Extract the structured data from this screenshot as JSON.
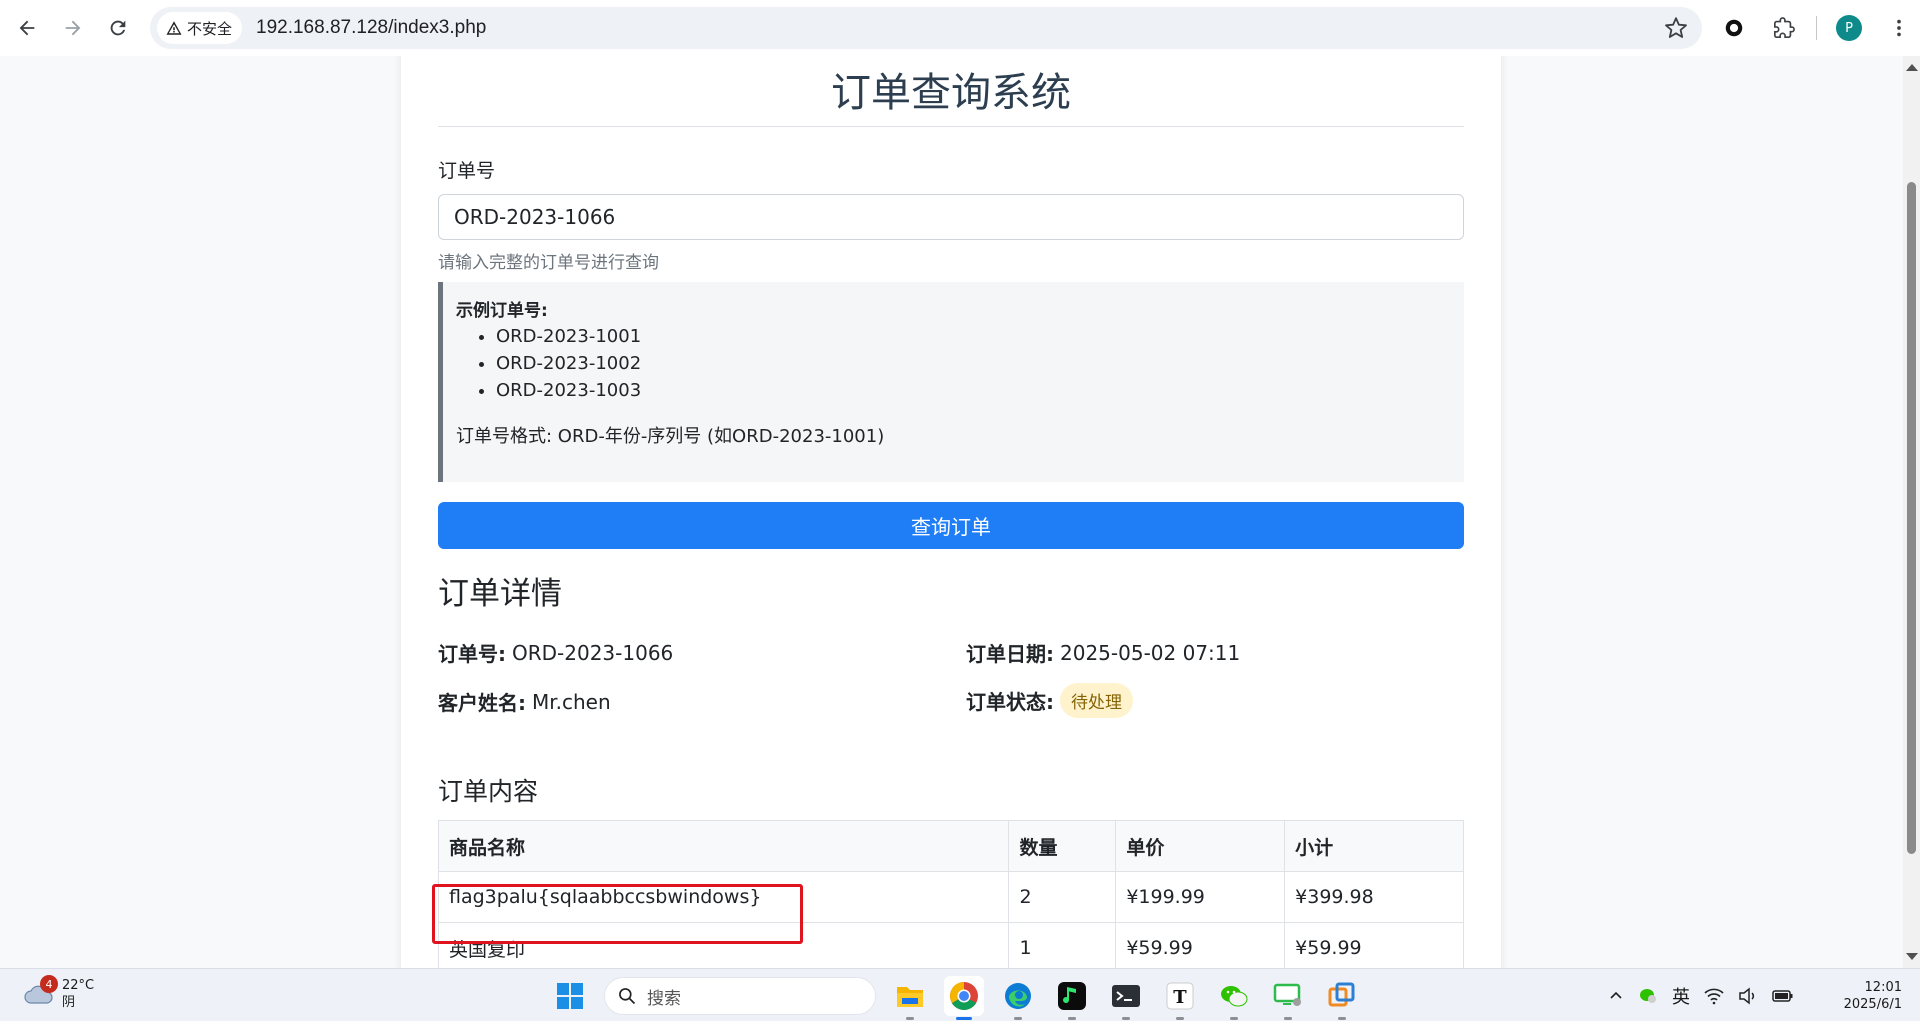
{
  "browser": {
    "security_label": "不安全",
    "url": "192.168.87.128/index3.php",
    "profile_initial": "P"
  },
  "page": {
    "title": "订单查询系统",
    "form": {
      "order_label": "订单号",
      "order_value": "ORD-2023-1066",
      "help_text": "请输入完整的订单号进行查询",
      "examples_title": "示例订单号:",
      "examples": [
        "ORD-2023-1001",
        "ORD-2023-1002",
        "ORD-2023-1003"
      ],
      "format_text": "订单号格式: ORD-年份-序列号 (如ORD-2023-1001)",
      "submit_label": "查询订单"
    },
    "details": {
      "title": "订单详情",
      "order_no_label": "订单号:",
      "order_no": "ORD-2023-1066",
      "order_date_label": "订单日期:",
      "order_date": "2025-05-02 07:11",
      "customer_label": "客户姓名:",
      "customer": "Mr.chen",
      "status_label": "订单状态:",
      "status": "待处理",
      "status_color": "#fff3cd"
    },
    "contents": {
      "title": "订单内容",
      "headers": [
        "商品名称",
        "数量",
        "单价",
        "小计"
      ],
      "rows": [
        [
          "flag3palu{sqlaabbccsbwindows}",
          "2",
          "¥199.99",
          "¥399.98"
        ],
        [
          "英国复印",
          "1",
          "¥59.99",
          "¥59.99"
        ]
      ]
    },
    "accent_color": "#1f7df5",
    "highlight_color": "#e0141e"
  },
  "taskbar": {
    "weather_badge": "4",
    "temperature": "22°C",
    "weather": "阴",
    "search_placeholder": "搜索",
    "ime": "英",
    "time": "12:01",
    "date": "2025/6/1"
  }
}
